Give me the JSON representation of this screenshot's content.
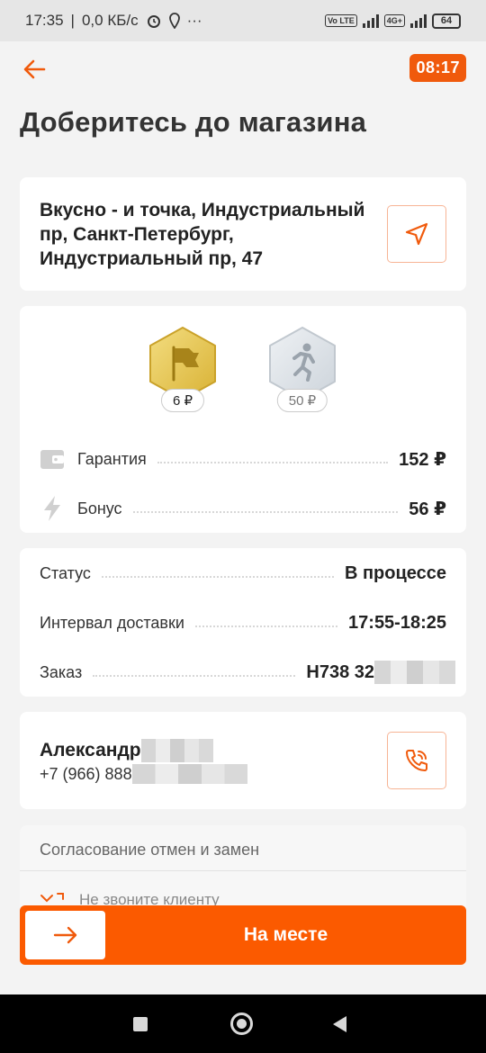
{
  "status_bar": {
    "time": "17:35",
    "speed": "0,0 КБ/с",
    "dots": "···",
    "battery": "64",
    "volte": "Vo LTE",
    "net": "4G+"
  },
  "header": {
    "timer": "08:17"
  },
  "page_title": "Доберитесь до магазина",
  "address": {
    "line1": "Вкусно - и точка, Индустриальный",
    "line2": "пр, Санкт-Петербург,",
    "line3": "Индустриальный пр, 47"
  },
  "badges": [
    {
      "amount": "6 ₽"
    },
    {
      "amount": "50 ₽"
    }
  ],
  "payments": {
    "guarantee_label": "Гарантия",
    "guarantee_value": "152 ₽",
    "bonus_label": "Бонус",
    "bonus_value": "56 ₽"
  },
  "order": {
    "status_label": "Статус",
    "status_value": "В процессе",
    "interval_label": "Интервал доставки",
    "interval_value": "17:55-18:25",
    "order_label": "Заказ",
    "order_value": "Н738 32"
  },
  "contact": {
    "name": "Александр",
    "phone": "+7 (966) 888"
  },
  "approval": {
    "title": "Согласование отмен и замен",
    "line": "Не звоните клиенту"
  },
  "action": {
    "label": "На месте"
  },
  "colors": {
    "accent": "#fb5a00",
    "gold": "#e5c64a",
    "silver": "#d3d9e0"
  }
}
